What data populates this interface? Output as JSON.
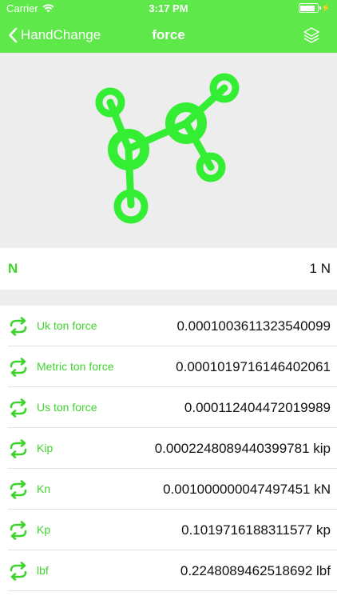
{
  "status_bar": {
    "carrier": "Carrier",
    "time": "3:17 PM"
  },
  "nav": {
    "back_label": "HandChange",
    "title": "force"
  },
  "base_unit": {
    "label": "N",
    "value": "1 N"
  },
  "conversions": [
    {
      "name": "Uk ton force",
      "value": "0.0001003611323540099"
    },
    {
      "name": "Metric ton force",
      "value": "0.0001019716146402061"
    },
    {
      "name": "Us ton force",
      "value": "0.000112404472019989"
    },
    {
      "name": "Kip",
      "value": "0.0002248089440399781 kip"
    },
    {
      "name": "Kn",
      "value": "0.001000000047497451 kN"
    },
    {
      "name": "Kp",
      "value": "0.1019716188311577 kp"
    },
    {
      "name": "lbf",
      "value": "0.2248089462518692 lbf"
    }
  ],
  "colors": {
    "accent": "#5fe84a",
    "accent_text": "#3fd42d",
    "background_gray": "#ededed"
  },
  "icons": [
    "wifi-icon",
    "battery-icon",
    "back-chevron-icon",
    "layers-icon",
    "molecule-logo-icon",
    "swap-arrows-icon"
  ]
}
